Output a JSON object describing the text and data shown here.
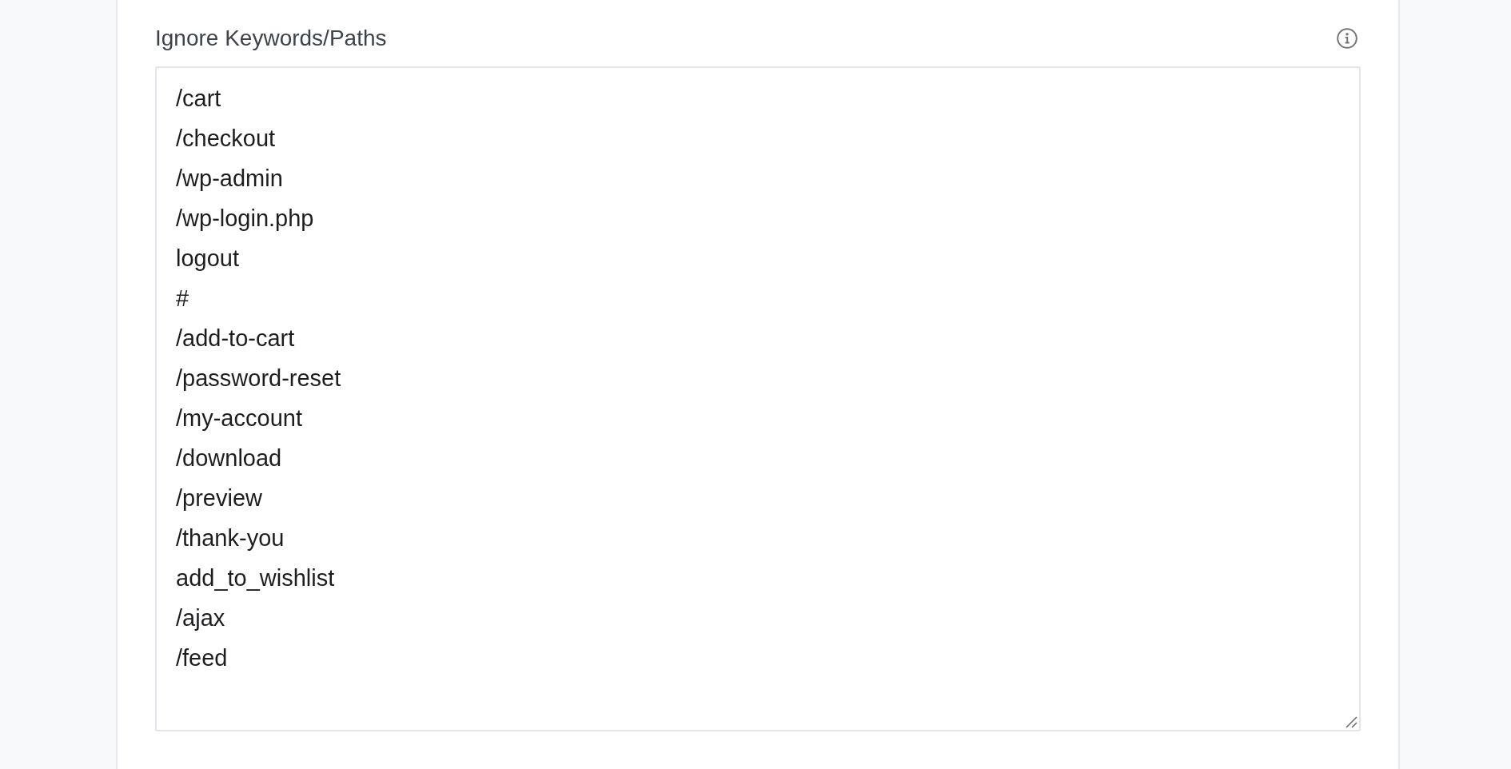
{
  "field": {
    "label": "Ignore Keywords/Paths",
    "value": [
      "/cart",
      "/checkout",
      "/wp-admin",
      "/wp-login.php",
      "logout",
      "#",
      "/add-to-cart",
      "/password-reset",
      "/my-account",
      "/download",
      "/preview",
      "/thank-you",
      "add_to_wishlist",
      "/ajax",
      "/feed"
    ]
  }
}
